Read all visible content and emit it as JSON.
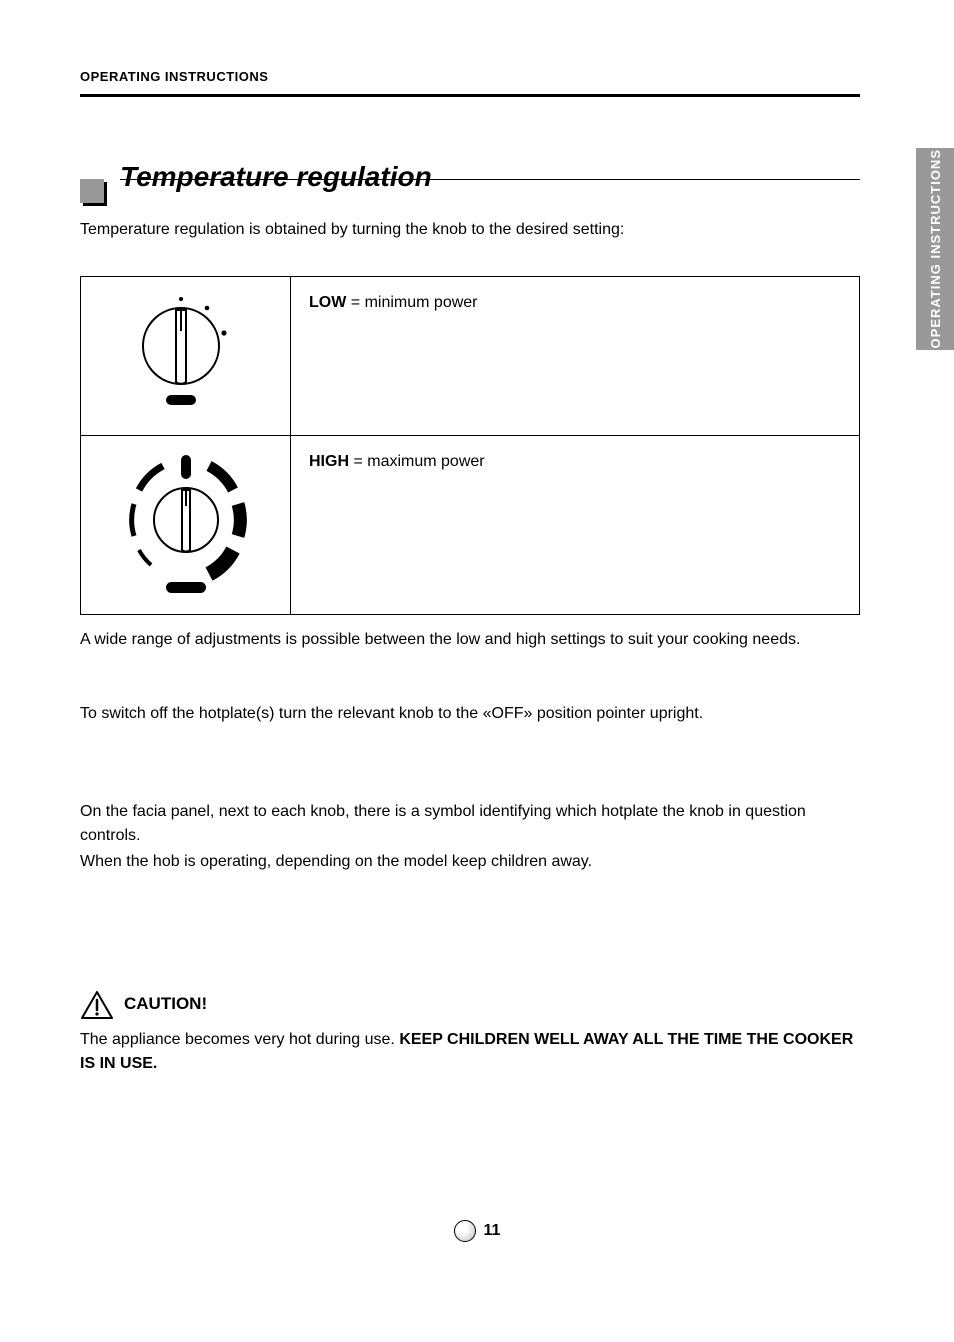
{
  "header": "OPERATING INSTRUCTIONS",
  "side_tab": "OPERATING INSTRUCTIONS",
  "section_title": "Temperature regulation",
  "intro_prefix": "Temperature regulation is obtained by turning the knob to the desired setting:",
  "intro_note": "",
  "knobs": [
    {
      "label": "LOW",
      "desc": "minimum power"
    },
    {
      "label": "HIGH",
      "desc": "maximum power"
    }
  ],
  "para1": "A wide range of adjustments is possible between the low and high settings to suit your cooking needs.",
  "para2": "To switch off the hotplate(s) turn the relevant knob to the «OFF» position pointer upright.",
  "para3_prefix": "On the facia panel, next to each knob, there is a symbol identifying which hotplate the knob in question controls.",
  "para3_suffix": "",
  "para4": "When the hob is operating, depending on the model keep children away.",
  "caution_title": "CAUTION!",
  "caution_body_prefix": "The appliance becomes very hot during use.",
  "caution_body_kw": "KEEP CHILDREN WELL AWAY ALL THE TIME THE COOKER IS IN USE.",
  "page_number": "11"
}
